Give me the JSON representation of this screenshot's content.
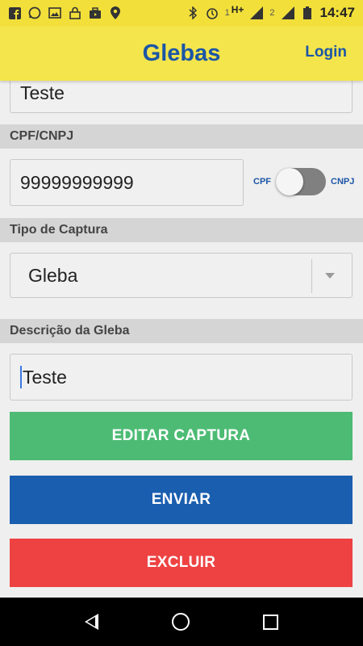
{
  "status_bar": {
    "sim1": "1",
    "network": "H+",
    "sim2": "2",
    "time": "14:47",
    "icons": [
      "facebook-icon",
      "whatsapp-icon",
      "image-icon",
      "lock-icon",
      "briefcase-icon",
      "location-icon",
      "bluetooth-icon",
      "alarm-icon",
      "signal-icon",
      "battery-icon"
    ]
  },
  "app_bar": {
    "title": "Glebas",
    "login_label": "Login"
  },
  "form": {
    "name_value": "Teste",
    "cpf_cnpj_label": "CPF/CNPJ",
    "cpf_cnpj_value": "99999999999",
    "toggle_left_label": "CPF",
    "toggle_right_label": "CNPJ",
    "tipo_label": "Tipo de Captura",
    "tipo_selected": "Gleba",
    "descricao_label": "Descrição da Gleba",
    "descricao_value": "Teste"
  },
  "buttons": {
    "editar_label": "EDITAR CAPTURA",
    "enviar_label": "ENVIAR",
    "excluir_label": "EXCLUIR"
  },
  "colors": {
    "appbar": "#f4e54c",
    "brand_blue": "#1b56a6",
    "green": "#4dbb74",
    "blue": "#1a5eaf",
    "red": "#ee4242"
  }
}
